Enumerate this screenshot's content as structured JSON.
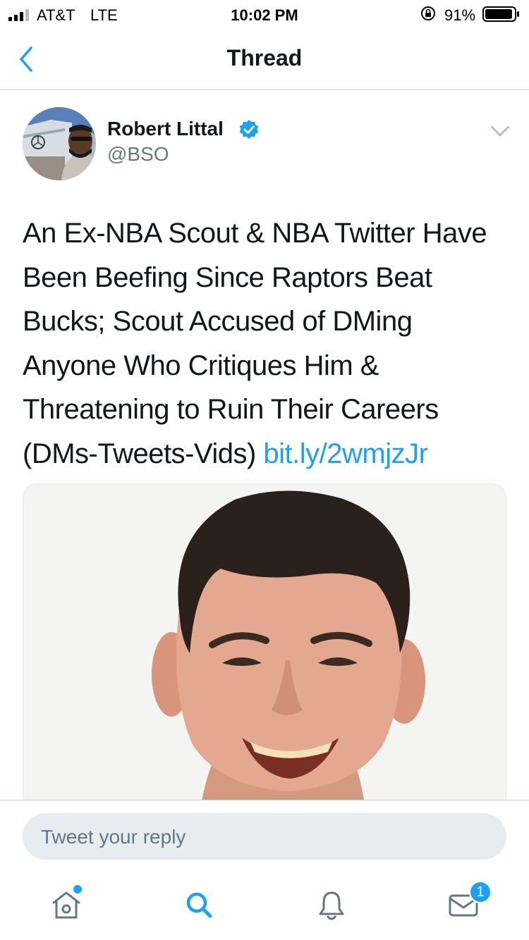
{
  "status_bar": {
    "carrier": "AT&T",
    "network": "LTE",
    "time": "10:02 PM",
    "battery": "91%"
  },
  "nav": {
    "title": "Thread",
    "back_icon": "chevron-left-icon"
  },
  "tweet": {
    "author_name": "Robert Littal",
    "author_handle": "@BSO",
    "verified": true,
    "text_lines": [
      "An Ex-NBA Scout & NBA Twitter Have",
      "Been Beefing Since Raptors Beat",
      "Bucks; Scout Accused of DMing",
      "Anyone Who Critiques Him &",
      "Threatening to Ruin Their Careers",
      "(DMs-Tweets-Vids) "
    ],
    "link": "bit.ly/2wmjzJr"
  },
  "reply": {
    "placeholder": "Tweet your reply"
  },
  "tabs": {
    "home": "home-icon",
    "search": "search-icon",
    "notifications": "bell-icon",
    "messages": "mail-icon",
    "messages_badge": "1"
  },
  "colors": {
    "accent": "#1da1f2",
    "text": "#14171a",
    "secondary": "#657786",
    "divider": "#ccd6dd"
  }
}
